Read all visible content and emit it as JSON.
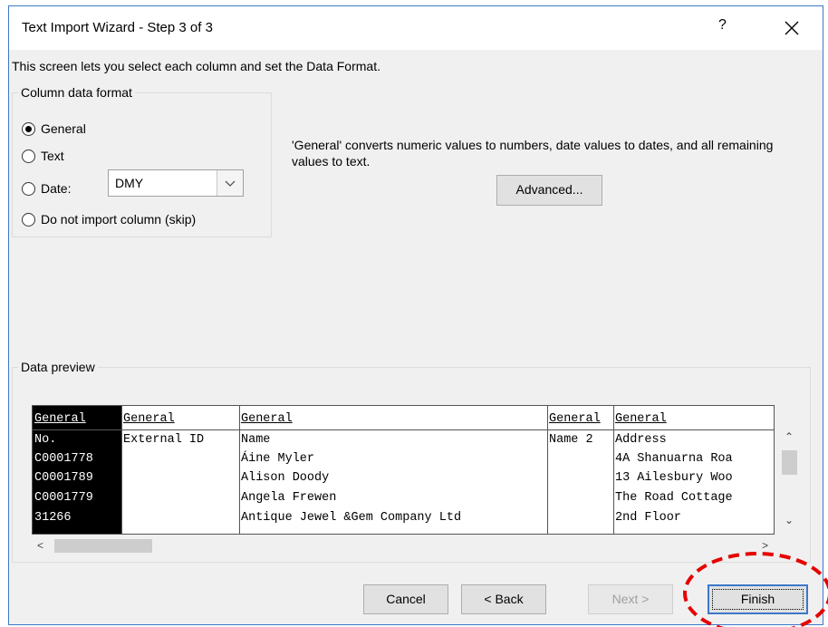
{
  "window": {
    "title": "Text Import Wizard - Step 3 of 3",
    "help_label": "?",
    "close_icon": "close-icon"
  },
  "intro": "This screen lets you select each column and set the Data Format.",
  "column_format": {
    "legend": "Column data format",
    "options": [
      {
        "label": "General",
        "selected": true
      },
      {
        "label": "Text",
        "selected": false
      },
      {
        "label": "Date:",
        "selected": false
      },
      {
        "label": "Do not import column (skip)",
        "selected": false
      }
    ],
    "date_value": "DMY"
  },
  "description": "'General' converts numeric values to numbers, date values to dates, and all remaining values to text.",
  "advanced_label": "Advanced...",
  "preview": {
    "legend": "Data preview",
    "headers": [
      "General",
      "General",
      "General",
      "General",
      "General"
    ],
    "columns": [
      [
        "No.",
        "C0001778",
        "C0001789",
        "C0001779",
        "31266"
      ],
      [
        "External ID",
        "",
        "",
        "",
        ""
      ],
      [
        "Name",
        "Áine Myler",
        "Alison Doody",
        "Angela Frewen",
        "Antique Jewel &Gem Company Ltd"
      ],
      [
        "Name 2",
        "",
        "",
        "",
        ""
      ],
      [
        "Address",
        "4A Shanuarna Roa",
        "13 Ailesbury Woo",
        "The Road Cottage",
        "2nd Floor"
      ]
    ]
  },
  "buttons": {
    "cancel": "Cancel",
    "back": "< Back",
    "next": "Next >",
    "finish": "Finish"
  },
  "colors": {
    "accent": "#3c78c8",
    "highlight_circle": "#e60000"
  }
}
